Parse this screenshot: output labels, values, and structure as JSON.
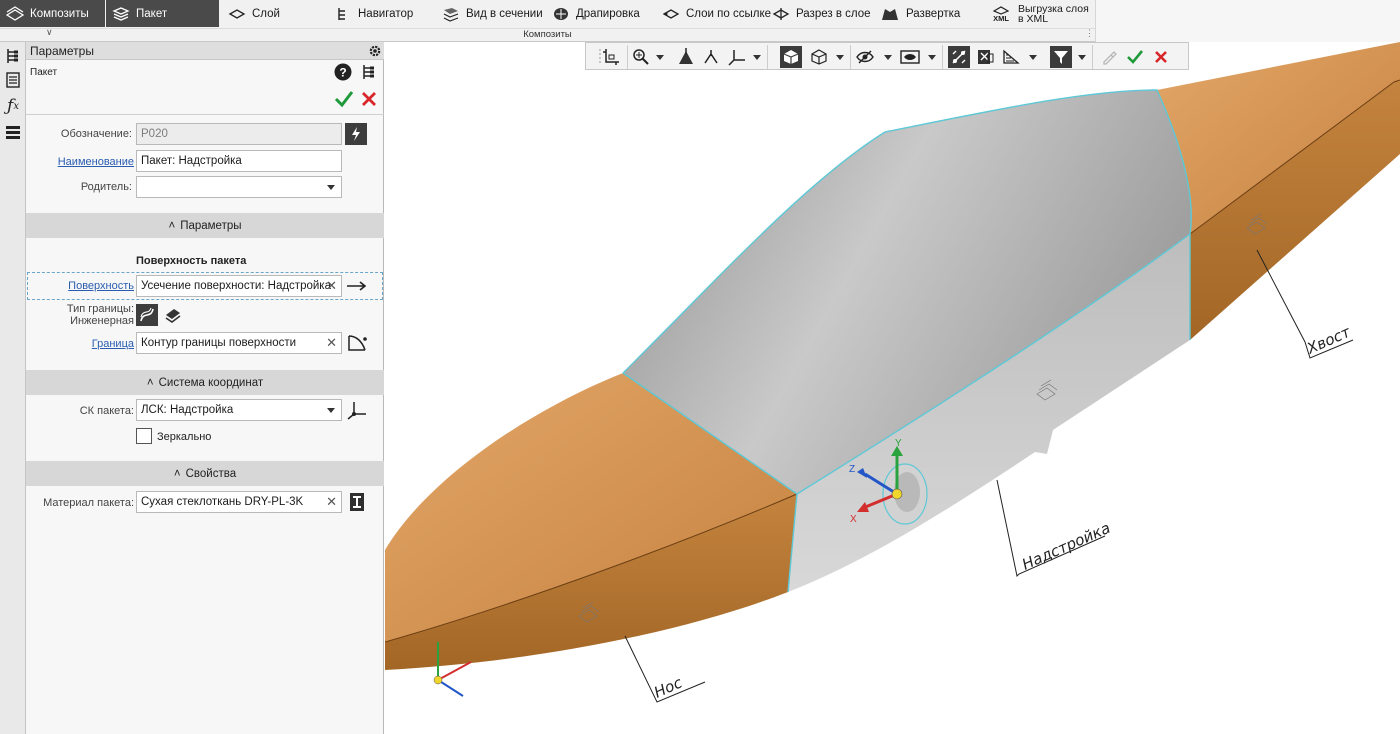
{
  "ribbon": {
    "tabs": [
      {
        "label": "Композиты",
        "icon": "composites-icon"
      },
      {
        "label": "Пакет",
        "icon": "package-icon"
      },
      {
        "label": "Слой",
        "icon": "layer-icon"
      },
      {
        "label": "Навигатор",
        "icon": "navigator-icon"
      },
      {
        "label": "Вид в сечении",
        "icon": "section-view-icon"
      },
      {
        "label": "Драпировка",
        "icon": "draping-icon"
      },
      {
        "label": "Слои по ссылке",
        "icon": "linked-layers-icon"
      },
      {
        "label": "Разрез в слое",
        "icon": "layer-cut-icon"
      },
      {
        "label": "Развертка",
        "icon": "flat-pattern-icon"
      },
      {
        "label_line1": "Выгрузка слоя",
        "label_line2": "в XML",
        "icon": "xml-export-icon",
        "icon_text": "XML"
      }
    ],
    "group_label": "Композиты"
  },
  "panel": {
    "title": "Параметры",
    "subtitle": "Пакет",
    "fields": {
      "designation": {
        "label": "Обозначение:",
        "value": "P020"
      },
      "name": {
        "label": "Наименование",
        "value": "Пакет: Надстройка"
      },
      "parent": {
        "label": "Родитель:",
        "value": ""
      },
      "surface": {
        "label": "Поверхность",
        "value": "Усечение поверхности: Надстройка"
      },
      "boundary_type": {
        "label_line1": "Тип границы:",
        "label_line2": "Инженерная"
      },
      "boundary": {
        "label": "Граница",
        "value": "Контур границы поверхности"
      },
      "cs": {
        "label": "СК пакета:",
        "value": "ЛСК: Надстройка"
      },
      "mirror": {
        "label": "Зеркально",
        "checked": false
      },
      "material": {
        "label": "Материал пакета:",
        "value": "Сухая стеклоткань DRY-PL-3K"
      }
    },
    "sections": {
      "params": "Параметры",
      "surface_group": "Поверхность пакета",
      "cs": "Система координат",
      "props": "Свойства"
    }
  },
  "viewport": {
    "annotations": [
      "Хвост",
      "Надстройка",
      "Нос"
    ],
    "axis_labels": {
      "x": "X",
      "y": "Y",
      "z": "Z"
    }
  },
  "colors": {
    "orange_part": "#c98a45",
    "gray_part": "#a9a9a9",
    "edge_highlight": "#5ec8d6",
    "ok_green": "#1f9a3a",
    "cancel_red": "#d8262a"
  }
}
